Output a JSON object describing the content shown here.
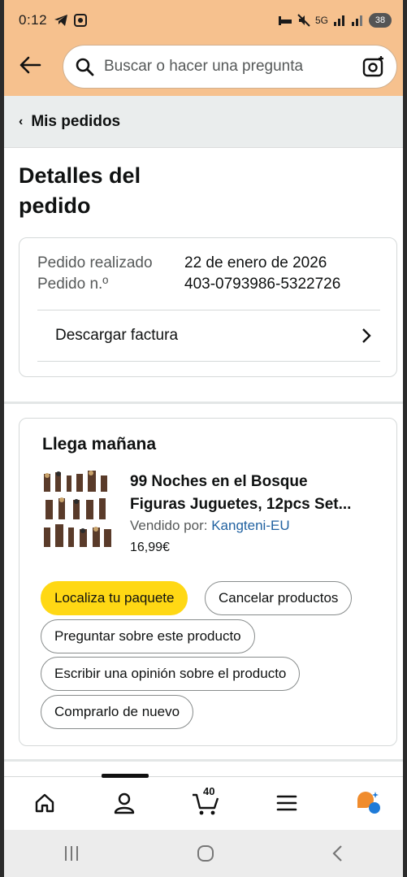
{
  "status_bar": {
    "time": "0:12",
    "network": "5G",
    "battery": "38"
  },
  "header": {
    "back_icon": "back-arrow-icon",
    "search_placeholder": "Buscar o hacer una pregunta",
    "camera_icon": "camera-search-icon"
  },
  "breadcrumb": {
    "label": "Mis pedidos"
  },
  "page": {
    "title_line1": "Detalles del",
    "title_line2": "pedido"
  },
  "order_info": {
    "placed_label": "Pedido realizado",
    "placed_value": "22 de enero de 2026",
    "number_label": "Pedido n.º",
    "number_value": "403-0793986-5322726",
    "download_label": "Descargar factura"
  },
  "shipment": {
    "status": "Llega mañana",
    "product_title_line1": "99 Noches en el Bosque",
    "product_title_line2": "Figuras Juguetes, 12pcs Set...",
    "sold_by_label": "Vendido por:",
    "seller": "Kangteni-EU",
    "price": "16,99€",
    "actions": {
      "track": "Localiza tu paquete",
      "cancel": "Cancelar productos",
      "ask": "Preguntar sobre este producto",
      "review": "Escribir una opinión sobre el producto",
      "rebuy": "Comprarlo de nuevo"
    }
  },
  "tabbar": {
    "cart_count": "40"
  },
  "colors": {
    "header_bg": "#f6c18e",
    "primary_button": "#ffd814",
    "link": "#2162a1"
  }
}
